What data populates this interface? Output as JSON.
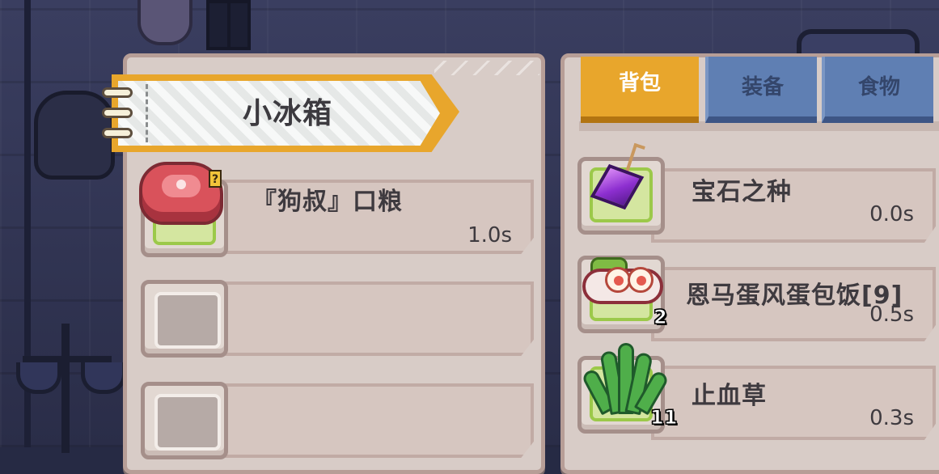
{
  "fridge": {
    "title": "小冰箱",
    "slots": [
      {
        "name": "『狗叔』口粮",
        "time": "1.0s",
        "badge": "?"
      },
      {
        "name": "",
        "time": ""
      },
      {
        "name": "",
        "time": ""
      }
    ]
  },
  "bag": {
    "tabs": [
      {
        "label": "背包",
        "active": true
      },
      {
        "label": "装备",
        "active": false
      },
      {
        "label": "食物",
        "active": false
      }
    ],
    "items": [
      {
        "name": "宝石之种",
        "time": "0.0s",
        "count": ""
      },
      {
        "name": "恩马蛋风蛋包饭[9]",
        "time": "0.5s",
        "count": "2"
      },
      {
        "name": "止血草",
        "time": "0.3s",
        "count": "11"
      }
    ]
  },
  "colors": {
    "accent": "#e8a62c",
    "tab_inactive": "#5f7fb3",
    "panel": "#d8ccc7",
    "text": "#3e3a3f"
  }
}
